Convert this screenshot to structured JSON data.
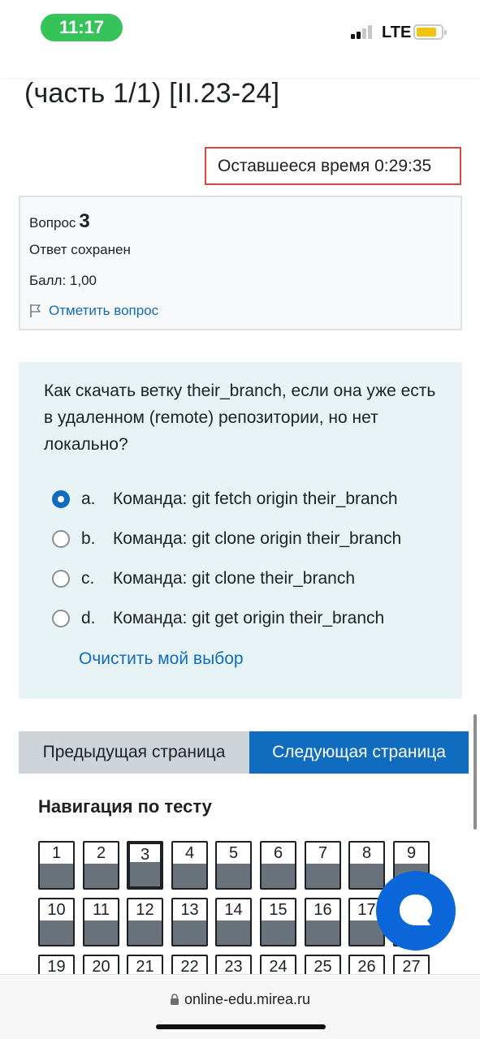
{
  "status_bar": {
    "time": "11:17",
    "network": "LTE"
  },
  "page": {
    "title": "(часть 1/1) [II.23-24]",
    "timer": "Оставшееся время 0:29:35"
  },
  "info": {
    "question_label": "Вопрос",
    "question_number": "3",
    "state": "Ответ сохранен",
    "grade": "Балл: 1,00",
    "flag_label": "Отметить вопрос"
  },
  "question": {
    "text": "Как скачать ветку their_branch, если она уже есть в удаленном (remote) репозитории, но нет локально?",
    "answers": [
      {
        "letter": "a.",
        "text": "Команда: git fetch origin their_branch",
        "selected": true
      },
      {
        "letter": "b.",
        "text": "Команда: git clone origin their_branch",
        "selected": false
      },
      {
        "letter": "c.",
        "text": "Команда: git clone their_branch",
        "selected": false
      },
      {
        "letter": "d.",
        "text": "Команда: git get origin their_branch",
        "selected": false
      }
    ],
    "clear_label": "Очистить мой выбор"
  },
  "buttons": {
    "prev": "Предыдущая страница",
    "next": "Следующая страница"
  },
  "quiz_nav": {
    "heading": "Навигация по тесту",
    "current": "3",
    "items": [
      "1",
      "2",
      "3",
      "4",
      "5",
      "6",
      "7",
      "8",
      "9",
      "10",
      "11",
      "12",
      "13",
      "14",
      "15",
      "16",
      "17",
      "18",
      "19",
      "20",
      "21",
      "22",
      "23",
      "24",
      "25",
      "26",
      "27"
    ]
  },
  "url_bar": {
    "url": "online-edu.mirea.ru"
  },
  "icons": {
    "flag": "flag-icon",
    "chat": "chat-icon",
    "lock": "lock-icon"
  },
  "colors": {
    "accent": "#0f6cbf",
    "timer_border": "#d44a42",
    "question_bg": "#e7f3f5",
    "time_pill": "#36c35a",
    "battery": "#f2c40e"
  }
}
